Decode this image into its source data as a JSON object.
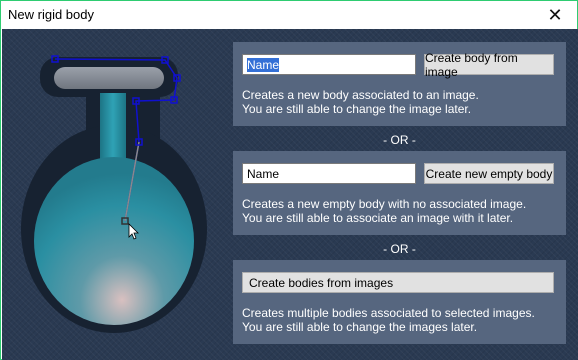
{
  "window": {
    "title": "New rigid body",
    "close_glyph": "✕"
  },
  "panel_image": {
    "name_value_selected": "Name",
    "button_label": "Create body from image",
    "description_line1": "Creates a new body associated to an image.",
    "description_line2": "You are still able to change the image later."
  },
  "separator_1": "- OR -",
  "panel_empty": {
    "name_value": "Name",
    "button_label": "Create new empty body",
    "description_line1": "Creates a new empty body with no associated image.",
    "description_line2": "You are still able to associate an image with it later."
  },
  "separator_2": "- OR -",
  "panel_multiple": {
    "button_label": "Create bodies from images",
    "description_line1": "Creates multiple bodies associated to selected images.",
    "description_line2": "You are still able to change the images later."
  },
  "colors": {
    "background": "#2a3a52",
    "panel": "#56667f",
    "flask_outline": "#1a2433",
    "flask_liquid": "#2a8ea0",
    "selection_handles": "#1010c0",
    "window_border": "#2ecc71"
  },
  "icons": {
    "close": "close-icon",
    "cursor": "mouse-cursor-icon",
    "flask": "flask-preview-image"
  }
}
